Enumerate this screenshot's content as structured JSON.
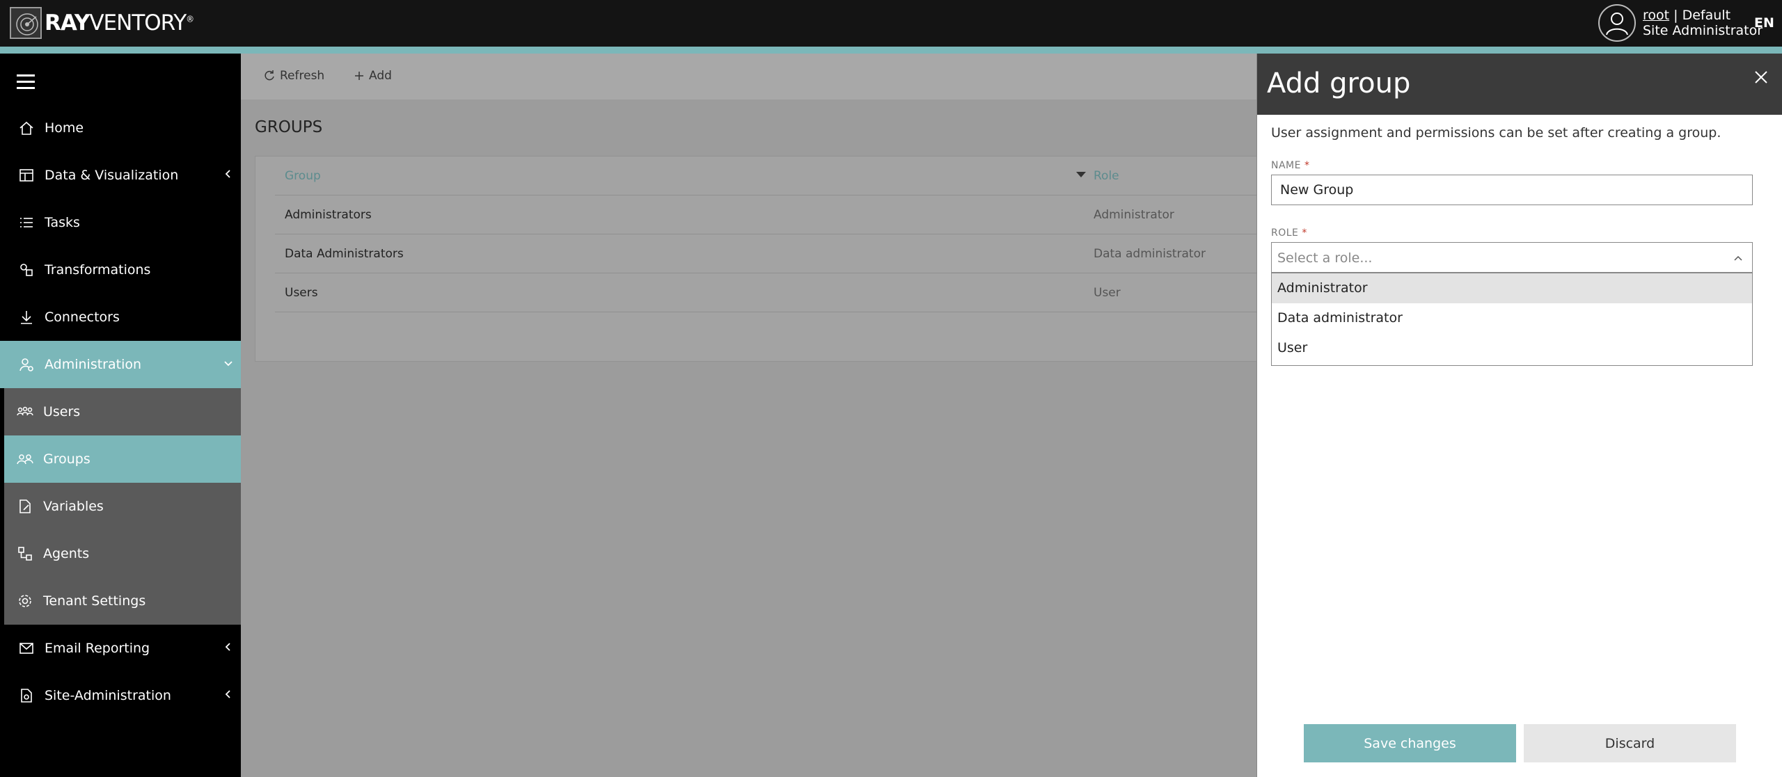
{
  "header": {
    "logo_bold": "RAY",
    "logo_light": "VENTORY",
    "logo_mark": "®",
    "user_name": "root",
    "separator": "|",
    "tenant": "Default",
    "user_role": "Site Administrator",
    "language": "EN"
  },
  "sidebar": {
    "items": [
      {
        "label": "Home",
        "icon": "home-icon"
      },
      {
        "label": "Data & Visualization",
        "icon": "dashboard-icon"
      },
      {
        "label": "Tasks",
        "icon": "tasks-icon"
      },
      {
        "label": "Transformations",
        "icon": "transformations-icon"
      },
      {
        "label": "Connectors",
        "icon": "download-icon"
      },
      {
        "label": "Administration",
        "icon": "user-settings-icon"
      },
      {
        "label": "Users",
        "icon": "users-icon"
      },
      {
        "label": "Groups",
        "icon": "groups-icon"
      },
      {
        "label": "Variables",
        "icon": "variables-icon"
      },
      {
        "label": "Agents",
        "icon": "agents-icon"
      },
      {
        "label": "Tenant Settings",
        "icon": "gear-icon"
      },
      {
        "label": "Email Reporting",
        "icon": "email-icon"
      },
      {
        "label": "Site-Administration",
        "icon": "site-admin-icon"
      }
    ]
  },
  "toolbar": {
    "refresh_label": "Refresh",
    "add_label": "Add"
  },
  "main": {
    "title": "GROUPS",
    "columns": {
      "group": "Group",
      "role": "Role"
    },
    "rows": [
      {
        "group": "Administrators",
        "role": "Administrator"
      },
      {
        "group": "Data Administrators",
        "role": "Data administrator"
      },
      {
        "group": "Users",
        "role": "User"
      }
    ]
  },
  "drawer": {
    "title": "Add group",
    "info": "User assignment and permissions can be set after creating a group.",
    "name_label": "NAME",
    "name_value": "New Group",
    "role_label": "ROLE",
    "required_mark": "*",
    "role_placeholder": "Select a role...",
    "role_options": [
      "Administrator",
      "Data administrator",
      "User"
    ],
    "save_label": "Save changes",
    "discard_label": "Discard"
  },
  "colors": {
    "accent": "#7bb7b9",
    "header_bg": "#141414",
    "sidebar_bg": "#000000",
    "submenu_bg": "#5a5a5a",
    "drawer_head_bg": "#3b3b3b"
  }
}
